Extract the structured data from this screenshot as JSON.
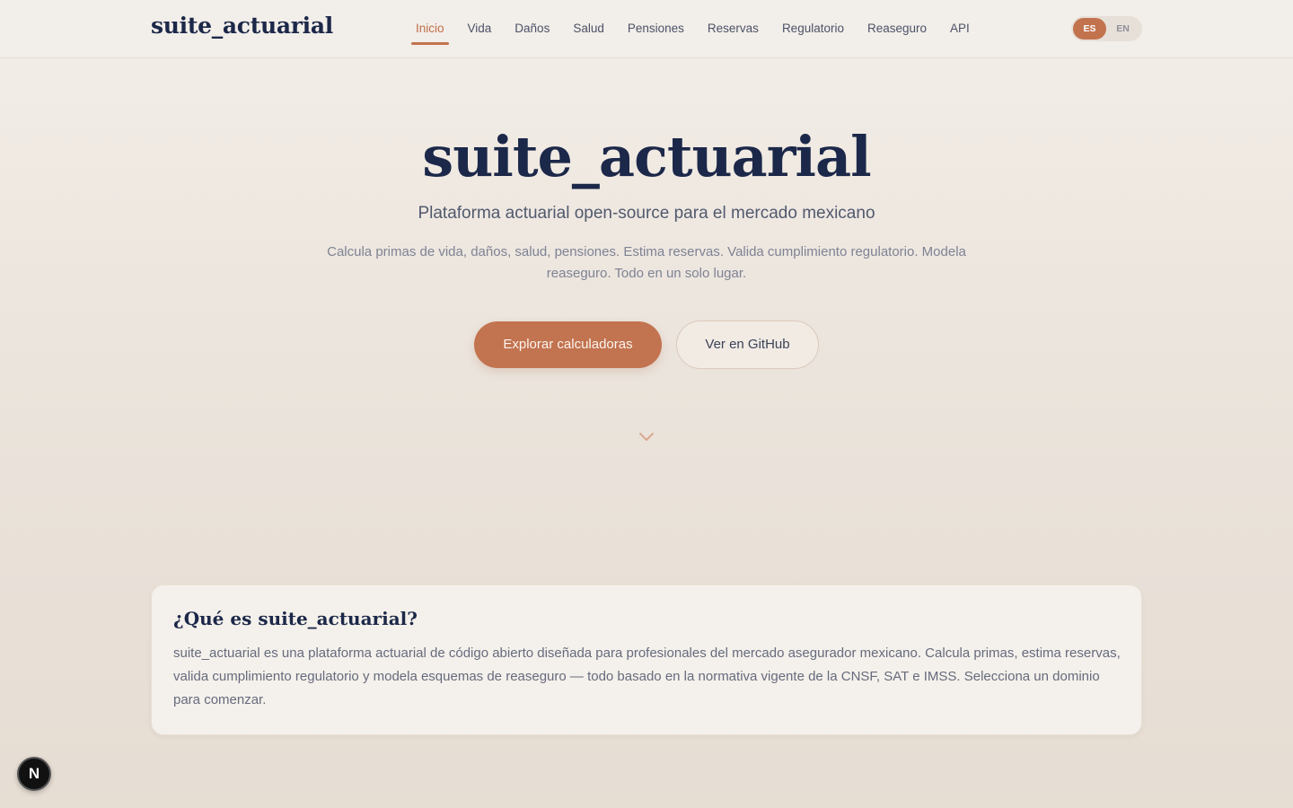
{
  "header": {
    "brand": "suite_actuarial",
    "nav": [
      {
        "label": "Inicio",
        "active": true
      },
      {
        "label": "Vida"
      },
      {
        "label": "Daños"
      },
      {
        "label": "Salud"
      },
      {
        "label": "Pensiones"
      },
      {
        "label": "Reservas"
      },
      {
        "label": "Regulatorio"
      },
      {
        "label": "Reaseguro"
      },
      {
        "label": "API"
      }
    ],
    "lang": {
      "es": "ES",
      "en": "EN",
      "selected": "ES"
    }
  },
  "hero": {
    "title": "suite_actuarial",
    "subtitle": "Plataforma actuarial open-source para el mercado mexicano",
    "description": "Calcula primas de vida, daños, salud, pensiones. Estima reservas. Valida cumplimiento regulatorio. Modela reaseguro. Todo en un solo lugar.",
    "primary_button": "Explorar calculadoras",
    "secondary_button": "Ver en GitHub",
    "scroll_icon": "chevron-down-icon"
  },
  "about": {
    "title": "¿Qué es suite_actuarial?",
    "text": "suite_actuarial es una plataforma actuarial de código abierto diseñada para profesionales del mercado asegurador mexicano. Calcula primas, estima reservas, valida cumplimiento regulatorio y modela esquemas de reaseguro — todo basado en la normativa vigente de la CNSF, SAT e IMSS. Selecciona un dominio para comenzar."
  },
  "dev_badge": {
    "label": "N",
    "icon": "nextjs-logo-icon"
  },
  "colors": {
    "accent": "#c2734e",
    "navy": "#1c2849",
    "background": "#ebe4dc"
  }
}
